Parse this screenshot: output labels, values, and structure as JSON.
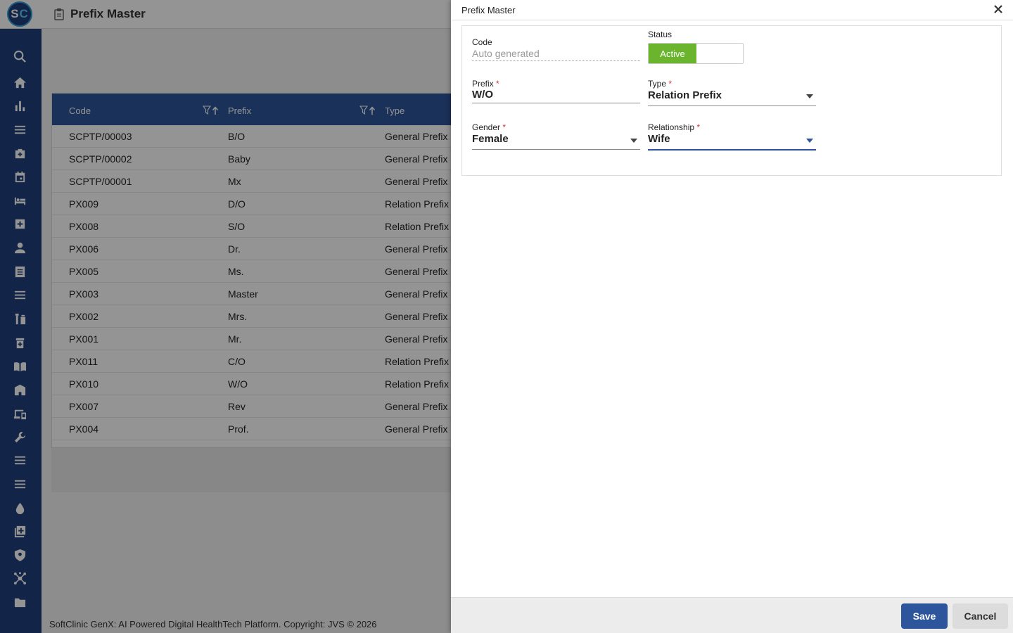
{
  "app": {
    "logo_text_s": "S",
    "logo_text_c": "C",
    "page_title": "Prefix Master",
    "footer": "SoftClinic GenX: AI Powered Digital HealthTech Platform. Copyright: JVS © 2026"
  },
  "sidebar": {
    "icons": [
      "search-icon",
      "home-icon",
      "bar-chart-icon",
      "menu-icon",
      "medical-bag-icon",
      "calendar-icon",
      "bed-icon",
      "plus-box-icon",
      "person-icon",
      "document-icon",
      "list-icon",
      "lab-icon",
      "pharmacy-icon",
      "book-icon",
      "building-icon",
      "devices-icon",
      "wrench-icon",
      "list-icon",
      "list-icon",
      "drop-icon",
      "add-box-icon",
      "shield-icon",
      "network-icon",
      "folder-icon"
    ]
  },
  "grid": {
    "columns": [
      "Code",
      "Prefix",
      "Type"
    ],
    "rows": [
      [
        "SCPTP/00003",
        "B/O",
        "General Prefix"
      ],
      [
        "SCPTP/00002",
        "Baby",
        "General Prefix"
      ],
      [
        "SCPTP/00001",
        "Mx",
        "General Prefix"
      ],
      [
        "PX009",
        "D/O",
        "Relation Prefix"
      ],
      [
        "PX008",
        "S/O",
        "Relation Prefix"
      ],
      [
        "PX006",
        "Dr.",
        "General Prefix"
      ],
      [
        "PX005",
        "Ms.",
        "General Prefix"
      ],
      [
        "PX003",
        "Master",
        "General Prefix"
      ],
      [
        "PX002",
        "Mrs.",
        "General Prefix"
      ],
      [
        "PX001",
        "Mr.",
        "General Prefix"
      ],
      [
        "PX011",
        "C/O",
        "Relation Prefix"
      ],
      [
        "PX010",
        "W/O",
        "Relation Prefix"
      ],
      [
        "PX007",
        "Rev",
        "General Prefix"
      ],
      [
        "PX004",
        "Prof.",
        "General Prefix"
      ]
    ]
  },
  "drawer": {
    "title": "Prefix Master",
    "code": {
      "label": "Code",
      "value": "Auto generated"
    },
    "status": {
      "label": "Status",
      "active_label": "Active",
      "value": "Active"
    },
    "prefix": {
      "label": "Prefix",
      "required": "*",
      "value": "W/O"
    },
    "type": {
      "label": "Type",
      "required": "*",
      "value": "Relation Prefix"
    },
    "gender": {
      "label": "Gender",
      "required": "*",
      "value": "Female"
    },
    "relationship": {
      "label": "Relationship",
      "required": "*",
      "value": "Wife"
    },
    "save_label": "Save",
    "cancel_label": "Cancel"
  },
  "colors": {
    "brand": "#1f3f7a",
    "header": "#2d559b",
    "active_green": "#6ab42e"
  }
}
